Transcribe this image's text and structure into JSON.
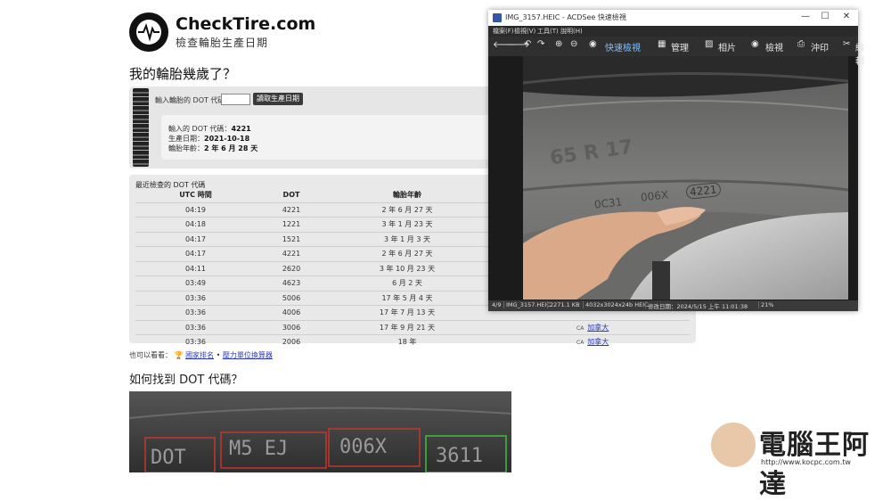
{
  "site": {
    "name": "CheckTire.com",
    "subtitle": "檢查輪胎生產日期",
    "question": "我的輪胎幾歲了？",
    "form": {
      "label": "輸入輪胎的 DOT 代碼",
      "input_value": "",
      "button": "讀取生產日期"
    },
    "result": {
      "dot_label": "輸入的 DOT 代碼：",
      "dot_value": "4221",
      "date_label": "生產日期：",
      "date_value": "2021-10-18",
      "age_label": "輪胎年齡：",
      "age_value": "2 年 6 月 28 天"
    },
    "recent": {
      "title": "最近檢查的 DOT 代碼",
      "headers": [
        "UTC 時間",
        "DOT",
        "輪胎年齡"
      ],
      "rows": [
        {
          "time": "04:19",
          "dot": "4221",
          "age": "2 年 6 月 27 天",
          "cc": "",
          "country": ""
        },
        {
          "time": "04:18",
          "dot": "1221",
          "age": "3 年 1 月 23 天",
          "cc": "",
          "country": ""
        },
        {
          "time": "04:17",
          "dot": "1521",
          "age": "3 年 1 月 3 天",
          "cc": "",
          "country": ""
        },
        {
          "time": "04:17",
          "dot": "4221",
          "age": "2 年 6 月 27 天",
          "cc": "",
          "country": ""
        },
        {
          "time": "04:11",
          "dot": "2620",
          "age": "3 年 10 月 23 天",
          "cc": "",
          "country": ""
        },
        {
          "time": "03:49",
          "dot": "4623",
          "age": "6 月 2 天",
          "cc": "",
          "country": ""
        },
        {
          "time": "03:36",
          "dot": "5006",
          "age": "17 年 5 月 4 天",
          "cc": "",
          "country": ""
        },
        {
          "time": "03:36",
          "dot": "4006",
          "age": "17 年 7 月 13 天",
          "cc": "",
          "country": ""
        },
        {
          "time": "03:36",
          "dot": "3006",
          "age": "17 年 9 月 21 天",
          "cc": "CA",
          "country": "加拿大"
        },
        {
          "time": "03:36",
          "dot": "2006",
          "age": "18 年",
          "cc": "CA",
          "country": "加拿大"
        }
      ]
    },
    "also": {
      "label": "也可以看看：",
      "link1": "國家排名",
      "bullet": "•",
      "link2": "壓力單位換算器"
    },
    "how_title": "如何找到 DOT 代碼？",
    "photo_codes": [
      "DOT",
      "M5 EJ",
      "006X",
      "3611"
    ]
  },
  "acdsee": {
    "title": "IMG_3157.HEIC - ACDSee 快速檢視",
    "controls": {
      "minimize": "—",
      "maximize": "☐",
      "close": "✕"
    },
    "menu": [
      "檔案(F)",
      "檢視(V)",
      "工具(T)",
      "說明(H)"
    ],
    "toolbar": {
      "quick_view": "快速檢視",
      "manage": "管理",
      "photos": "相片",
      "view": "檢視",
      "print": "沖印",
      "edit": "編輯"
    },
    "photo_text": {
      "sidewall": "65 R 17",
      "codes": [
        "0C31",
        "006X",
        "4221"
      ]
    },
    "status": {
      "index": "4/9",
      "filename": "IMG_3157.HEIC",
      "size": "2271.1 KB",
      "dims": "4032x3024x24b HEIC",
      "modified": "修改日期：2024/5/15 上午 11:01:38",
      "zoom": "21%"
    }
  },
  "watermark": {
    "text": "電腦王阿達",
    "url": "http://www.kocpc.com.tw"
  }
}
